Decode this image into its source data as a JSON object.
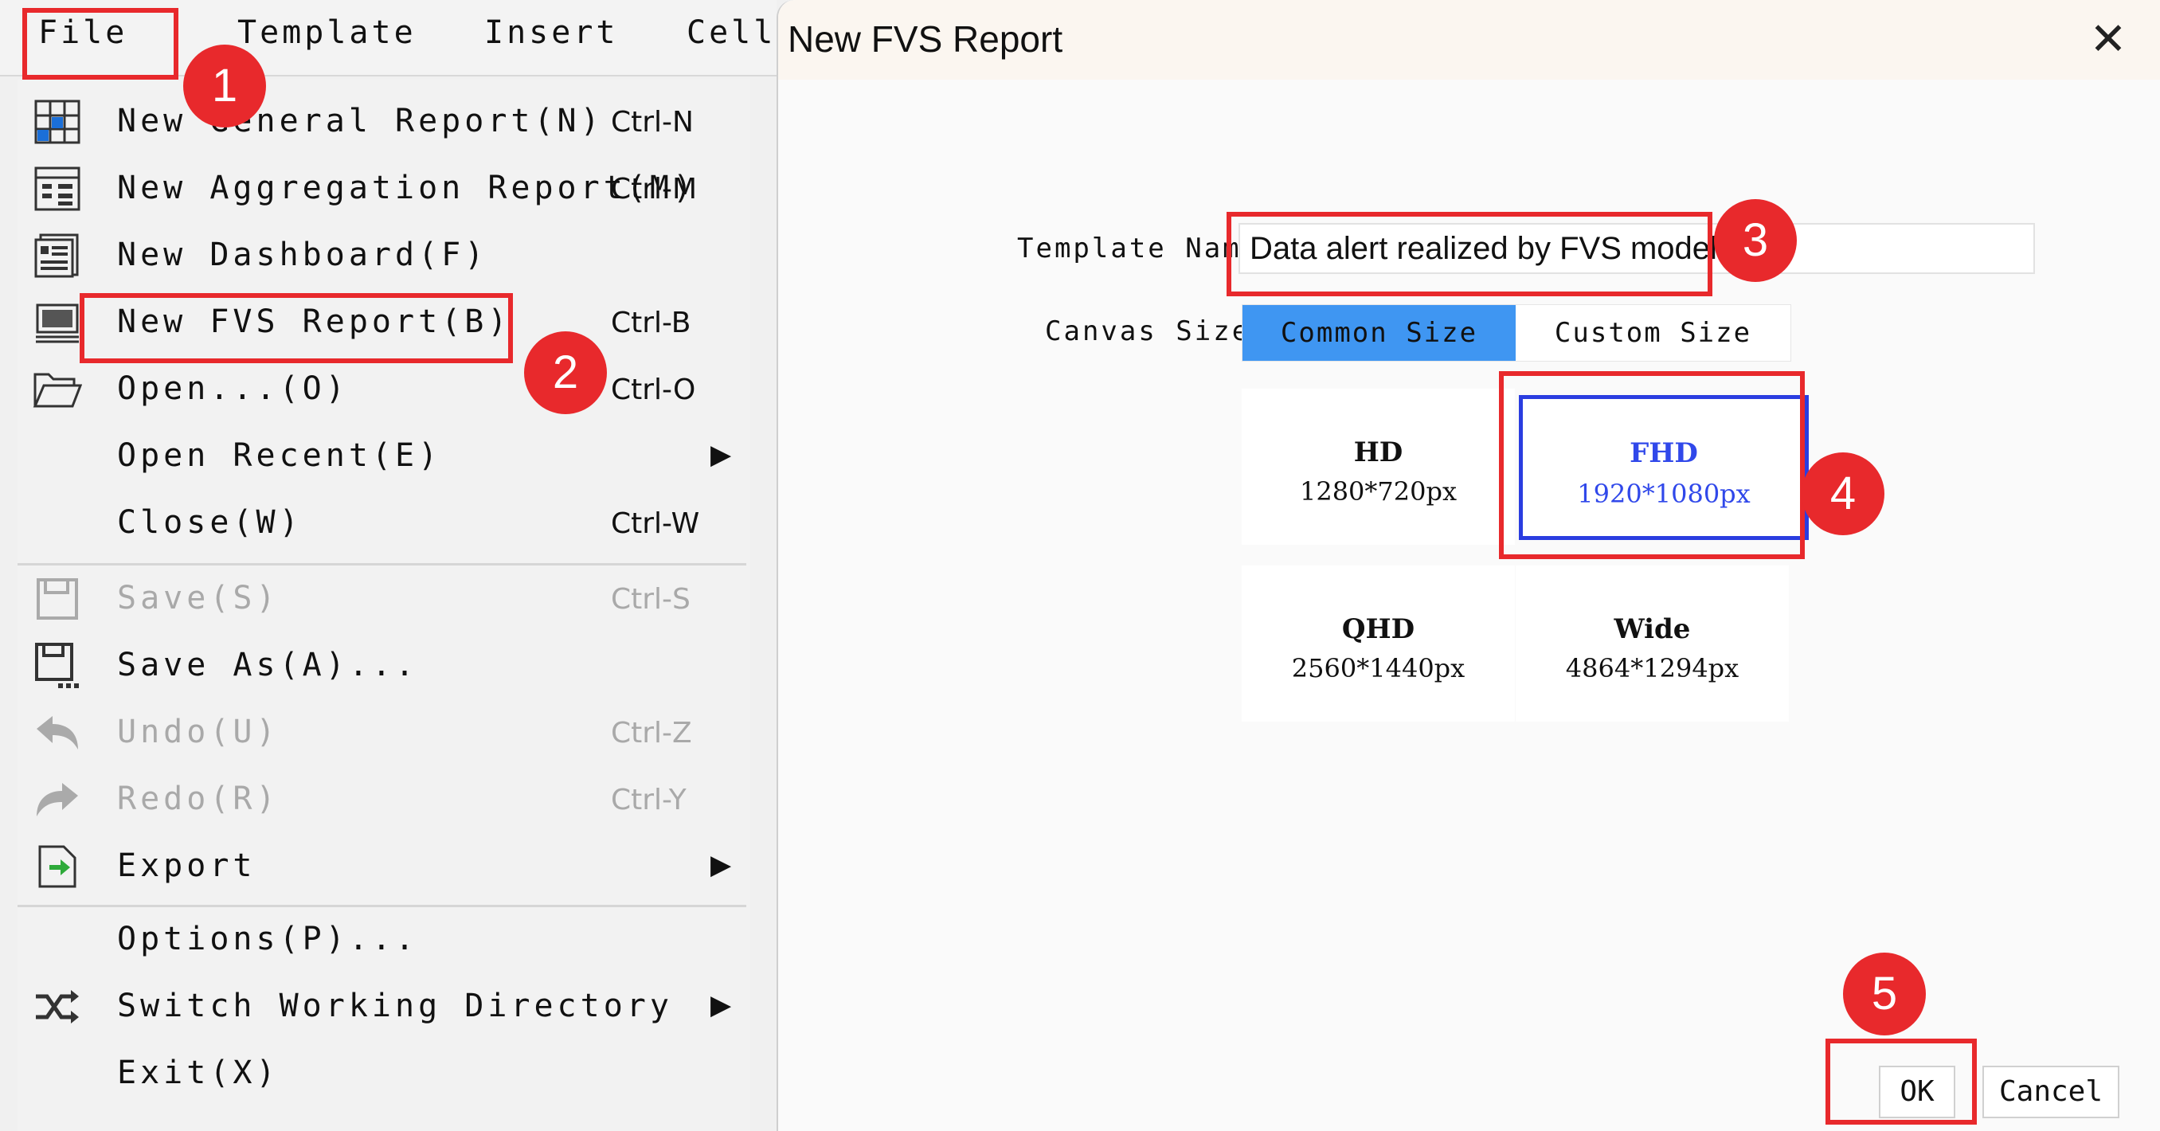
{
  "menubar": {
    "items": [
      "File",
      "Template",
      "Insert",
      "Cell"
    ]
  },
  "file_menu": {
    "items": [
      {
        "label": "New General Report(N)",
        "shortcut": "Ctrl-N",
        "icon": "grid-report-icon"
      },
      {
        "label": "New Aggregation Report(M)",
        "shortcut": "Ctrl-M",
        "icon": "aggregation-report-icon"
      },
      {
        "label": "New Dashboard(F)",
        "shortcut": "",
        "icon": "dashboard-icon"
      },
      {
        "label": "New FVS Report(B)",
        "shortcut": "Ctrl-B",
        "icon": "fvs-report-icon"
      },
      {
        "label": "Open...(O)",
        "shortcut": "Ctrl-O",
        "icon": "folder-open-icon"
      },
      {
        "label": "Open Recent(E)",
        "shortcut": "",
        "icon": ""
      },
      {
        "label": "Close(W)",
        "shortcut": "Ctrl-W",
        "icon": ""
      },
      {
        "label": "Save(S)",
        "shortcut": "Ctrl-S",
        "icon": "save-icon"
      },
      {
        "label": "Save As(A)...",
        "shortcut": "",
        "icon": "save-as-icon"
      },
      {
        "label": "Undo(U)",
        "shortcut": "Ctrl-Z",
        "icon": "undo-icon"
      },
      {
        "label": "Redo(R)",
        "shortcut": "Ctrl-Y",
        "icon": "redo-icon"
      },
      {
        "label": "Export",
        "shortcut": "",
        "icon": "export-icon"
      },
      {
        "label": "Options(P)...",
        "shortcut": "",
        "icon": ""
      },
      {
        "label": "Switch Working Directory",
        "shortcut": "",
        "icon": "switch-icon"
      },
      {
        "label": "Exit(X)",
        "shortcut": "",
        "icon": ""
      }
    ],
    "submenu_arrow": "▶"
  },
  "dialog": {
    "title": "New FVS Report",
    "close_glyph": "✕",
    "template_name_label": "Template Name",
    "template_name_value": "Data alert realized by FVS model",
    "canvas_size_label": "Canvas Size",
    "tabs": [
      "Common Size",
      "Custom Size"
    ],
    "sizes": [
      {
        "name": "HD",
        "dim": "1280*720px"
      },
      {
        "name": "FHD",
        "dim": "1920*1080px"
      },
      {
        "name": "QHD",
        "dim": "2560*1440px"
      },
      {
        "name": "Wide",
        "dim": "4864*1294px"
      }
    ],
    "ok_label": "OK",
    "cancel_label": "Cancel"
  },
  "annotations": [
    "1",
    "2",
    "3",
    "4",
    "5"
  ],
  "colors": {
    "annotation_red": "#e8292c",
    "tab_active": "#3f96f2",
    "selected_card": "#2a3de0"
  }
}
